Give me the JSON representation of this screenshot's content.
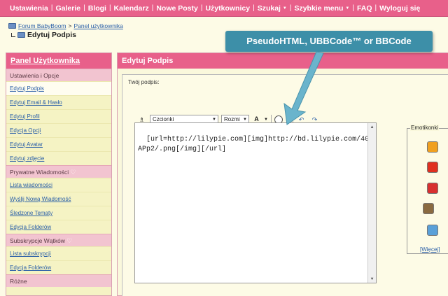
{
  "nav": {
    "items": [
      "Ustawienia",
      "Galerie",
      "Blogi",
      "Kalendarz",
      "Nowe Posty",
      "Użytkownicy",
      "Szukaj",
      "Szybkie menu",
      "FAQ",
      "Wyloguj się"
    ]
  },
  "breadcrumb": {
    "forum": "Forum BabyBoom",
    "sep": ">",
    "panel": "Panel użytkownika",
    "current": "Edytuj Podpis"
  },
  "sidebar": {
    "title": "Panel Użytkownika",
    "sections": [
      {
        "header": "Ustawienia i Opcje",
        "links": [
          "Edytuj Podpis",
          "Edytuj Email & Hasło",
          "Edytuj Profil",
          "Edycja Opcji",
          "Edytuj Avatar",
          "Edytuj zdjęcie"
        ]
      },
      {
        "header": "Prywatne Wiadomości",
        "links": [
          "Lista wiadomości",
          "Wyślij Nową Wiadomość",
          "Śledzone Tematy",
          "Edycja Folderów"
        ]
      },
      {
        "header": "Subskrypcje Wątków",
        "links": [
          "Lista subskrypcji",
          "Edycja Folderów"
        ]
      },
      {
        "header": "Różne",
        "links": []
      }
    ]
  },
  "main": {
    "title": "Edytuj Podpis",
    "label": "Twój podpis:",
    "font_select": "Czcionki",
    "size_select": "Rozmi",
    "editor_text": "[url=http://lilypie.com][img]http://bd.lilypie.com/40APp2/.png[/img][/url]",
    "emoticons_title": "Emotikonki",
    "emoticons_more": "[Więcej]",
    "emoticons": [
      {
        "name": "smile-emoticon",
        "color": "#f0a020"
      },
      {
        "name": "angry-emoticon",
        "color": "#e03020"
      },
      {
        "name": "tongue-emoticon",
        "color": "#d83030"
      },
      {
        "name": "cool-emoticon",
        "color": "#8a6a40"
      },
      {
        "name": "sleepy-emoticon",
        "color": "#5aa0d8"
      }
    ]
  },
  "callout": "PseudoHTML, UBBCode™ or BBCode",
  "colors": {
    "accent": "#e8608a",
    "callout": "#3d8fa8",
    "link": "#2a5fa8"
  }
}
